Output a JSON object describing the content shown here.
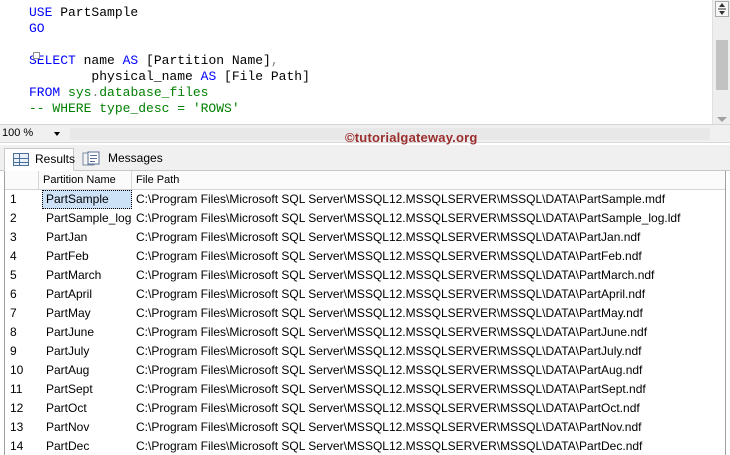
{
  "editor": {
    "lines": [
      {
        "kw1": "USE",
        "text": " PartSample"
      },
      {
        "kw1": "GO",
        "text": ""
      },
      {
        "blank": true
      },
      {
        "kw1": "SELECT",
        "id1": " name ",
        "kw2": "AS",
        "id2": " [Partition Name]",
        "gray1": ","
      },
      {
        "indent": "        ",
        "id1": "physical_name ",
        "kw2": "AS",
        "id2": " [File Path]"
      },
      {
        "kw1": "FROM",
        "id1": " ",
        "fn1": "sys",
        "gray1": ".",
        "fn2": "database_files"
      },
      {
        "comment": "-- WHERE type_desc = 'ROWS'"
      }
    ]
  },
  "zoom": {
    "value": "100 %"
  },
  "watermark": "©tutorialgateway.org",
  "tabs": {
    "results_label": "Results",
    "messages_label": "Messages"
  },
  "grid": {
    "columns": [
      "Partition Name",
      "File Path"
    ],
    "selected_row": 0,
    "rows": [
      {
        "num": "1",
        "name": "PartSample",
        "path": "C:\\Program Files\\Microsoft SQL Server\\MSSQL12.MSSQLSERVER\\MSSQL\\DATA\\PartSample.mdf"
      },
      {
        "num": "2",
        "name": "PartSample_log",
        "path": "C:\\Program Files\\Microsoft SQL Server\\MSSQL12.MSSQLSERVER\\MSSQL\\DATA\\PartSample_log.ldf"
      },
      {
        "num": "3",
        "name": "PartJan",
        "path": "C:\\Program Files\\Microsoft SQL Server\\MSSQL12.MSSQLSERVER\\MSSQL\\DATA\\PartJan.ndf"
      },
      {
        "num": "4",
        "name": "PartFeb",
        "path": "C:\\Program Files\\Microsoft SQL Server\\MSSQL12.MSSQLSERVER\\MSSQL\\DATA\\PartFeb.ndf"
      },
      {
        "num": "5",
        "name": "PartMarch",
        "path": "C:\\Program Files\\Microsoft SQL Server\\MSSQL12.MSSQLSERVER\\MSSQL\\DATA\\PartMarch.ndf"
      },
      {
        "num": "6",
        "name": "PartApril",
        "path": "C:\\Program Files\\Microsoft SQL Server\\MSSQL12.MSSQLSERVER\\MSSQL\\DATA\\PartApril.ndf"
      },
      {
        "num": "7",
        "name": "PartMay",
        "path": "C:\\Program Files\\Microsoft SQL Server\\MSSQL12.MSSQLSERVER\\MSSQL\\DATA\\PartMay.ndf"
      },
      {
        "num": "8",
        "name": "PartJune",
        "path": "C:\\Program Files\\Microsoft SQL Server\\MSSQL12.MSSQLSERVER\\MSSQL\\DATA\\PartJune.ndf"
      },
      {
        "num": "9",
        "name": "PartJuly",
        "path": "C:\\Program Files\\Microsoft SQL Server\\MSSQL12.MSSQLSERVER\\MSSQL\\DATA\\PartJuly.ndf"
      },
      {
        "num": "10",
        "name": "PartAug",
        "path": "C:\\Program Files\\Microsoft SQL Server\\MSSQL12.MSSQLSERVER\\MSSQL\\DATA\\PartAug.ndf"
      },
      {
        "num": "11",
        "name": "PartSept",
        "path": "C:\\Program Files\\Microsoft SQL Server\\MSSQL12.MSSQLSERVER\\MSSQL\\DATA\\PartSept.ndf"
      },
      {
        "num": "12",
        "name": "PartOct",
        "path": "C:\\Program Files\\Microsoft SQL Server\\MSSQL12.MSSQLSERVER\\MSSQL\\DATA\\PartOct.ndf"
      },
      {
        "num": "13",
        "name": "PartNov",
        "path": "C:\\Program Files\\Microsoft SQL Server\\MSSQL12.MSSQLSERVER\\MSSQL\\DATA\\PartNov.ndf"
      },
      {
        "num": "14",
        "name": "PartDec",
        "path": "C:\\Program Files\\Microsoft SQL Server\\MSSQL12.MSSQLSERVER\\MSSQL\\DATA\\PartDec.ndf"
      }
    ]
  }
}
